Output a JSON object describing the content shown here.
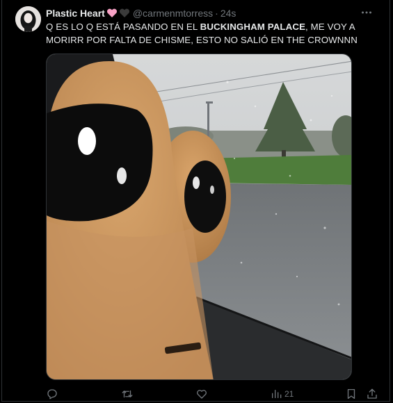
{
  "tweet": {
    "display_name": "Plastic Heart",
    "name_emojis": [
      "pink-heart-emoji",
      "black-heart-emoji"
    ],
    "handle": "@carmenmtorress",
    "separator": "·",
    "timestamp": "24s",
    "text_before": "Q ES LO Q ESTÁ PASANDO EN EL ",
    "text_bold": "BUCKINGHAM PALACE",
    "text_after": ", ME VOY A MORIRR POR FALTA DE CHISME, ESTO NO SALIÓ EN THE CROWNNN",
    "media_description_icon": "photo",
    "views_count": "21"
  },
  "actions": {
    "icons": [
      "reply-icon",
      "retweet-icon",
      "like-icon",
      "views-icon",
      "bookmark-icon",
      "share-icon"
    ]
  },
  "colors": {
    "background": "#000000",
    "text": "#e7e9ea",
    "muted": "#71767b",
    "border": "#2f3336",
    "pink_heart": "#f7a1c4"
  }
}
